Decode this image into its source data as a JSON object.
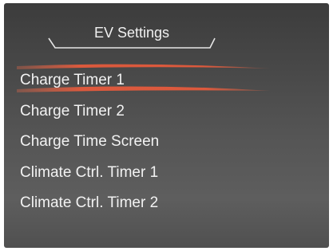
{
  "header": {
    "title": "EV Settings"
  },
  "menu": {
    "selected_index": 0,
    "highlight_color": "#d9563a",
    "items": [
      {
        "label": "Charge Timer 1"
      },
      {
        "label": "Charge Timer 2"
      },
      {
        "label": "Charge Time Screen"
      },
      {
        "label": "Climate Ctrl. Timer 1"
      },
      {
        "label": "Climate Ctrl. Timer 2"
      }
    ]
  }
}
